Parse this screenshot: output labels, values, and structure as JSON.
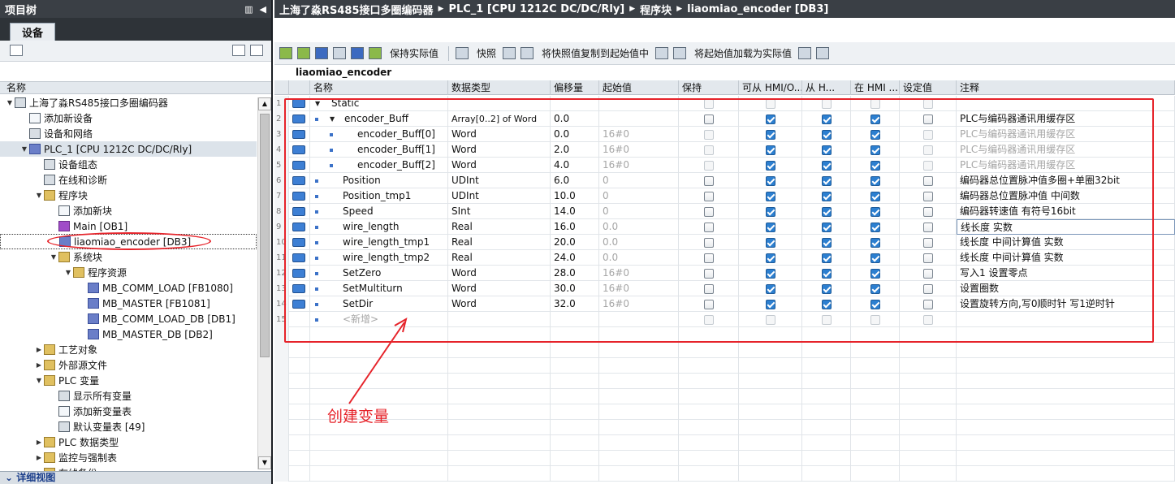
{
  "left_panel": {
    "title": "项目树",
    "tab": "设备",
    "header": "名称",
    "bottom": "详细视图",
    "tree": [
      {
        "label": "上海了淼RS485接口多圈编码器",
        "level": 0,
        "toggle": "▼",
        "icon": "project-icon"
      },
      {
        "label": "添加新设备",
        "level": 1,
        "toggle": "",
        "icon": "add-device-icon"
      },
      {
        "label": "设备和网络",
        "level": 1,
        "toggle": "",
        "icon": "network-icon"
      },
      {
        "label": "PLC_1 [CPU 1212C DC/DC/Rly]",
        "level": 1,
        "toggle": "▼",
        "icon": "plc-icon",
        "selected": true
      },
      {
        "label": "设备组态",
        "level": 2,
        "toggle": "",
        "icon": "device-config-icon"
      },
      {
        "label": "在线和诊断",
        "level": 2,
        "toggle": "",
        "icon": "diagnostics-icon"
      },
      {
        "label": "程序块",
        "level": 2,
        "toggle": "▼",
        "icon": "folder-icon"
      },
      {
        "label": "添加新块",
        "level": 3,
        "toggle": "",
        "icon": "add-block-icon"
      },
      {
        "label": "Main [OB1]",
        "level": 3,
        "toggle": "",
        "icon": "ob-icon"
      },
      {
        "label": "liaomiao_encoder [DB3]",
        "level": 3,
        "toggle": "",
        "icon": "db-icon",
        "focused": true
      },
      {
        "label": "系统块",
        "level": 3,
        "toggle": "▼",
        "icon": "folder-icon"
      },
      {
        "label": "程序资源",
        "level": 4,
        "toggle": "▼",
        "icon": "folder-icon"
      },
      {
        "label": "MB_COMM_LOAD [FB1080]",
        "level": 5,
        "toggle": "",
        "icon": "fb-icon"
      },
      {
        "label": "MB_MASTER [FB1081]",
        "level": 5,
        "toggle": "",
        "icon": "fb-icon"
      },
      {
        "label": "MB_COMM_LOAD_DB [DB1]",
        "level": 5,
        "toggle": "",
        "icon": "db-icon"
      },
      {
        "label": "MB_MASTER_DB [DB2]",
        "level": 5,
        "toggle": "",
        "icon": "db-icon"
      },
      {
        "label": "工艺对象",
        "level": 2,
        "toggle": "▶",
        "icon": "folder-icon"
      },
      {
        "label": "外部源文件",
        "level": 2,
        "toggle": "▶",
        "icon": "folder-icon"
      },
      {
        "label": "PLC 变量",
        "level": 2,
        "toggle": "▼",
        "icon": "folder-icon"
      },
      {
        "label": "显示所有变量",
        "level": 3,
        "toggle": "",
        "icon": "tag-table-icon"
      },
      {
        "label": "添加新变量表",
        "level": 3,
        "toggle": "",
        "icon": "add-tag-icon"
      },
      {
        "label": "默认变量表 [49]",
        "level": 3,
        "toggle": "",
        "icon": "tag-table-icon"
      },
      {
        "label": "PLC 数据类型",
        "level": 2,
        "toggle": "▶",
        "icon": "folder-icon"
      },
      {
        "label": "监控与强制表",
        "level": 2,
        "toggle": "▶",
        "icon": "folder-icon"
      },
      {
        "label": "在线备份",
        "level": 2,
        "toggle": "▶",
        "icon": "folder-icon"
      }
    ]
  },
  "breadcrumb": [
    "上海了淼RS485接口多圈编码器",
    "PLC_1 [CPU 1212C DC/DC/Rly]",
    "程序块",
    "liaomiao_encoder [DB3]"
  ],
  "toolbar": {
    "keep_actual": "保持实际值",
    "snapshot": "快照",
    "copy_snapshot": "将快照值复制到起始值中",
    "load_start": "将起始值加载为实际值"
  },
  "db_name": "liaomiao_encoder",
  "columns": [
    "名称",
    "数据类型",
    "偏移量",
    "起始值",
    "保持",
    "可从 HMI/O...",
    "从 H...",
    "在 HMI ...",
    "设定值",
    "注释"
  ],
  "rows": [
    {
      "num": "1",
      "name": "Static",
      "indent": 0,
      "tri": "▼",
      "type": "",
      "offset": "",
      "start": "",
      "retain": false,
      "hmi1": false,
      "hmi2": false,
      "hmi3": false,
      "setp": false,
      "comment": "",
      "dim": true,
      "section": true
    },
    {
      "num": "2",
      "name": "encoder_Buff",
      "indent": 1,
      "tri": "▼",
      "type": "Array[0..2] of Word",
      "offset": "0.0",
      "start": "",
      "retain": false,
      "hmi1": true,
      "hmi2": true,
      "hmi3": true,
      "setp": false,
      "comment": "PLC与编码器通讯用缓存区"
    },
    {
      "num": "3",
      "name": "encoder_Buff[0]",
      "indent": 2,
      "tri": "",
      "type": "Word",
      "offset": "0.0",
      "start": "16#0",
      "retain": false,
      "hmi1": true,
      "hmi2": true,
      "hmi3": true,
      "setp": false,
      "comment": "PLC与编码器通讯用缓存区",
      "child": true
    },
    {
      "num": "4",
      "name": "encoder_Buff[1]",
      "indent": 2,
      "tri": "",
      "type": "Word",
      "offset": "2.0",
      "start": "16#0",
      "retain": false,
      "hmi1": true,
      "hmi2": true,
      "hmi3": true,
      "setp": false,
      "comment": "PLC与编码器通讯用缓存区",
      "child": true
    },
    {
      "num": "5",
      "name": "encoder_Buff[2]",
      "indent": 2,
      "tri": "",
      "type": "Word",
      "offset": "4.0",
      "start": "16#0",
      "retain": false,
      "hmi1": true,
      "hmi2": true,
      "hmi3": true,
      "setp": false,
      "comment": "PLC与编码器通讯用缓存区",
      "child": true
    },
    {
      "num": "6",
      "name": "Position",
      "indent": 1,
      "tri": "",
      "type": "UDInt",
      "offset": "6.0",
      "start": "0",
      "retain": false,
      "hmi1": true,
      "hmi2": true,
      "hmi3": true,
      "setp": false,
      "comment": "编码器总位置脉冲值多圈+单圈32bit"
    },
    {
      "num": "7",
      "name": "Position_tmp1",
      "indent": 1,
      "tri": "",
      "type": "UDInt",
      "offset": "10.0",
      "start": "0",
      "retain": false,
      "hmi1": true,
      "hmi2": true,
      "hmi3": true,
      "setp": false,
      "comment": "编码器总位置脉冲值 中间数"
    },
    {
      "num": "8",
      "name": "Speed",
      "indent": 1,
      "tri": "",
      "type": "SInt",
      "offset": "14.0",
      "start": "0",
      "retain": false,
      "hmi1": true,
      "hmi2": true,
      "hmi3": true,
      "setp": false,
      "comment": "编码器转速值 有符号16bit"
    },
    {
      "num": "9",
      "name": "wire_length",
      "indent": 1,
      "tri": "",
      "type": "Real",
      "offset": "16.0",
      "start": "0.0",
      "retain": false,
      "hmi1": true,
      "hmi2": true,
      "hmi3": true,
      "setp": false,
      "comment": "线长度 实数",
      "editing": true
    },
    {
      "num": "10",
      "name": "wire_length_tmp1",
      "indent": 1,
      "tri": "",
      "type": "Real",
      "offset": "20.0",
      "start": "0.0",
      "retain": false,
      "hmi1": true,
      "hmi2": true,
      "hmi3": true,
      "setp": false,
      "comment": "线长度 中间计算值 实数"
    },
    {
      "num": "11",
      "name": "wire_length_tmp2",
      "indent": 1,
      "tri": "",
      "type": "Real",
      "offset": "24.0",
      "start": "0.0",
      "retain": false,
      "hmi1": true,
      "hmi2": true,
      "hmi3": true,
      "setp": false,
      "comment": "线长度 中间计算值 实数"
    },
    {
      "num": "12",
      "name": "SetZero",
      "indent": 1,
      "tri": "",
      "type": "Word",
      "offset": "28.0",
      "start": "16#0",
      "retain": false,
      "hmi1": true,
      "hmi2": true,
      "hmi3": true,
      "setp": false,
      "comment": "写入1 设置零点"
    },
    {
      "num": "13",
      "name": "SetMultiturn",
      "indent": 1,
      "tri": "",
      "type": "Word",
      "offset": "30.0",
      "start": "16#0",
      "retain": false,
      "hmi1": true,
      "hmi2": true,
      "hmi3": true,
      "setp": false,
      "comment": "设置圈数"
    },
    {
      "num": "14",
      "name": "SetDir",
      "indent": 1,
      "tri": "",
      "type": "Word",
      "offset": "32.0",
      "start": "16#0",
      "retain": false,
      "hmi1": true,
      "hmi2": true,
      "hmi3": true,
      "setp": false,
      "comment": "设置旋转方向,写0顺时针 写1逆时针"
    },
    {
      "num": "15",
      "name": "<新增>",
      "indent": 1,
      "tri": "",
      "type": "",
      "offset": "",
      "start": "",
      "retain": false,
      "hmi1": false,
      "hmi2": false,
      "hmi3": false,
      "setp": false,
      "comment": "",
      "dim": true,
      "add": true
    }
  ],
  "annotation": "创建变量",
  "colors": {
    "accent_red": "#e6232a",
    "check_blue": "#2c7fd0",
    "title_bar": "#3a3f45"
  }
}
